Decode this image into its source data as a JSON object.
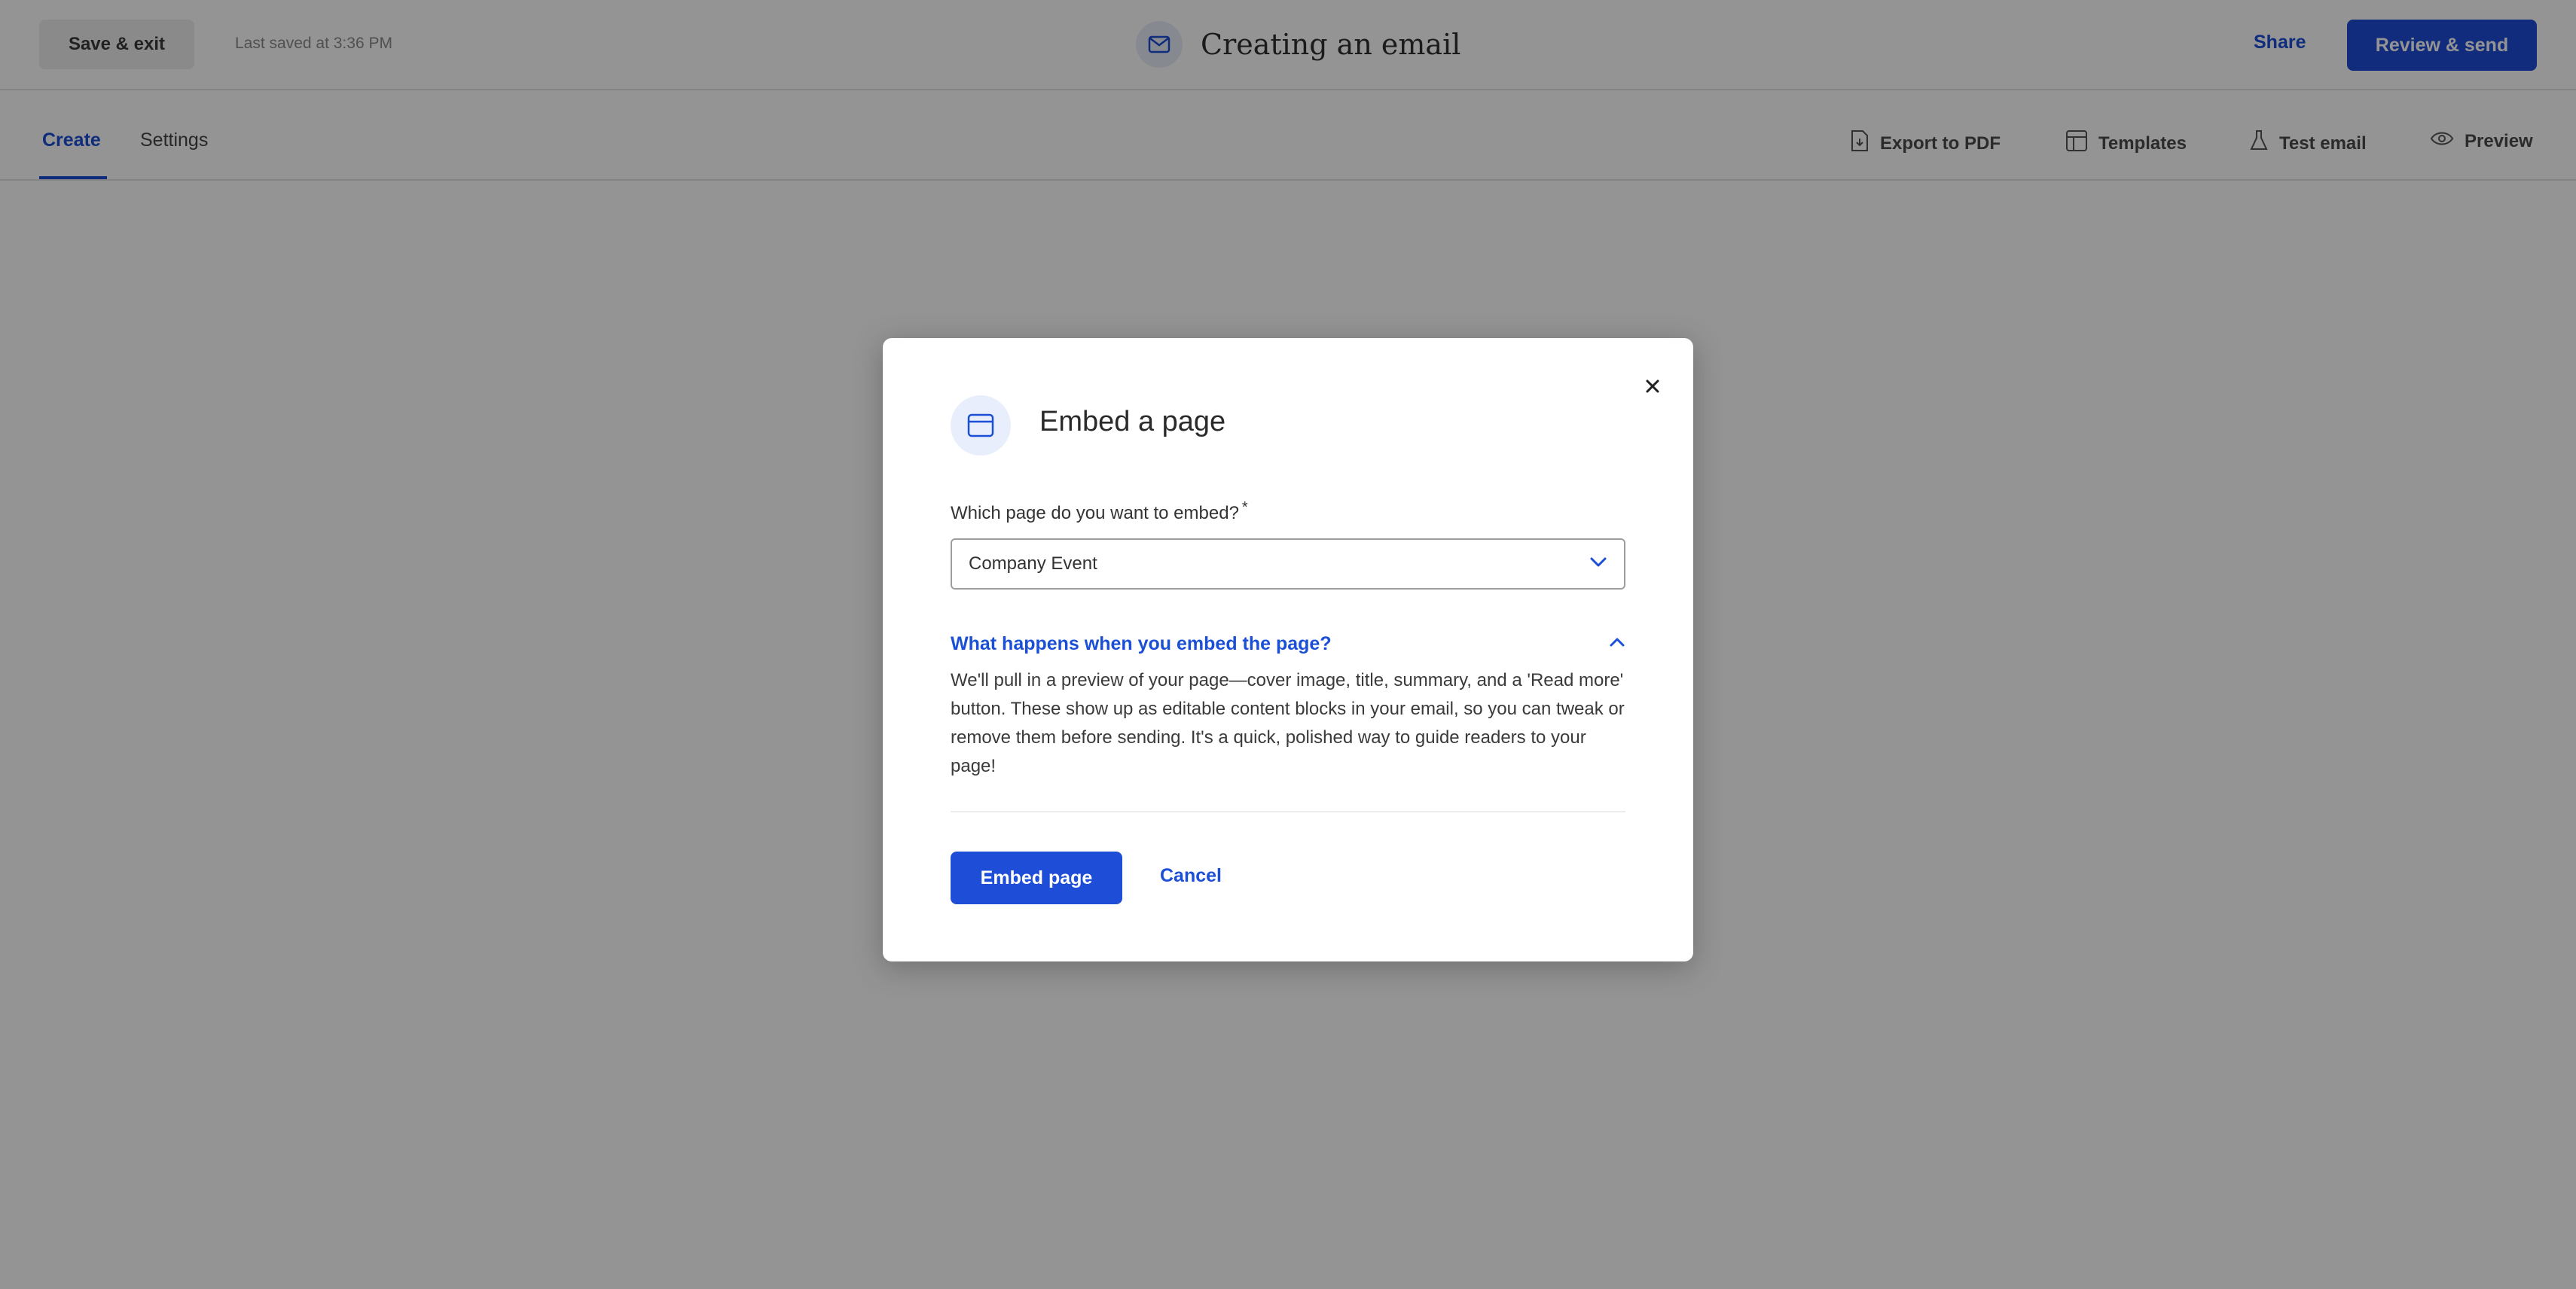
{
  "header": {
    "save_exit_label": "Save & exit",
    "last_saved": "Last saved at 3:36 PM",
    "title": "Creating an email",
    "share_label": "Share",
    "review_send_label": "Review & send"
  },
  "subnav": {
    "tabs": [
      {
        "label": "Create",
        "active": true
      },
      {
        "label": "Settings",
        "active": false
      }
    ],
    "tools": [
      {
        "label": "Export to PDF",
        "icon": "pdf-icon"
      },
      {
        "label": "Templates",
        "icon": "templates-icon"
      },
      {
        "label": "Test email",
        "icon": "flask-icon"
      },
      {
        "label": "Preview",
        "icon": "eye-icon"
      }
    ]
  },
  "modal": {
    "title": "Embed a page",
    "icon": "browser-window-icon",
    "field_label": "Which page do you want to embed?",
    "required_mark": "*",
    "selected_page": "Company Event",
    "accordion_title": "What happens when you embed the page?",
    "accordion_body": "We'll pull in a preview of your page—cover image, title, summary, and a 'Read more' button. These show up as editable content blocks in your email, so you can tweak or remove them before sending. It's a quick, polished way to guide readers to your page!",
    "primary_label": "Embed page",
    "cancel_label": "Cancel"
  },
  "colors": {
    "accent": "#1e4dd8",
    "overlay": "rgba(0,0,0,0.42)"
  }
}
